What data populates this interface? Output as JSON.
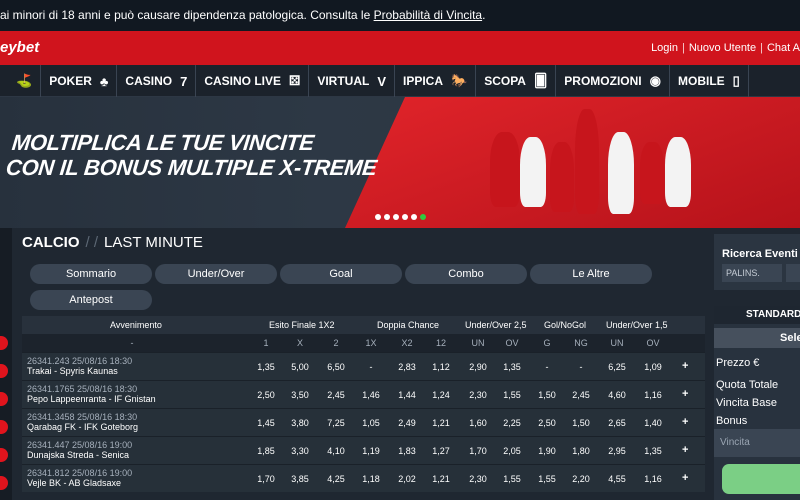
{
  "notice": {
    "text": "ai minori di 18 anni e può causare dipendenza patologica. Consulta le ",
    "link": "Probabilità di Vincita",
    "end": "."
  },
  "header": {
    "brand": "eybet",
    "links": [
      "Login",
      "Nuovo Utente",
      "Chat A"
    ]
  },
  "nav": [
    {
      "label": "",
      "icon": "golf-icon",
      "glyph": "⛳"
    },
    {
      "label": "POKER",
      "icon": "card-suits-icon",
      "glyph": "♣"
    },
    {
      "label": "CASINO",
      "icon": "seven-icon",
      "glyph": "7"
    },
    {
      "label": "CASINO LIVE",
      "icon": "dice-icon",
      "glyph": "⚄"
    },
    {
      "label": "VIRTUAL",
      "icon": "virtual-icon",
      "glyph": "V"
    },
    {
      "label": "IPPICA",
      "icon": "horse-icon",
      "glyph": "🐎"
    },
    {
      "label": "SCOPA",
      "icon": "cards-icon",
      "glyph": "🂠"
    },
    {
      "label": "PROMOZIONI",
      "icon": "promo-icon",
      "glyph": "◉"
    },
    {
      "label": "MOBILE",
      "icon": "mobile-icon",
      "glyph": "▯"
    }
  ],
  "banner": {
    "line1": "MOLTIPLICA LE TUE VINCITE",
    "line2": "CON IL BONUS MULTIPLE X-TREME",
    "slides": 6,
    "active_slide": 5
  },
  "section": {
    "title": "CALCIO",
    "sep": "/ /",
    "subtitle": "LAST MINUTE"
  },
  "filters": [
    "Sommario",
    "Under/Over",
    "Goal",
    "Combo",
    "Le Altre",
    "Antepost"
  ],
  "table": {
    "headers": [
      "Avvenimento",
      "Esito Finale 1X2",
      "Doppia Chance",
      "Under/Over 2,5",
      "Gol/NoGol",
      "Under/Over 1,5"
    ],
    "sub": [
      "-",
      "1",
      "X",
      "2",
      "1X",
      "X2",
      "12",
      "UN",
      "OV",
      "G",
      "NG",
      "UN",
      "OV"
    ],
    "rows": [
      {
        "code": "26341.243 25/08/16 18:30",
        "match": "Trakai - Spyris Kaunas",
        "odds": [
          "1,35",
          "5,00",
          "6,50",
          "-",
          "2,83",
          "1,12",
          "2,90",
          "1,35",
          "-",
          "-",
          "6,25",
          "1,09"
        ]
      },
      {
        "code": "26341.1765 25/08/16 18:30",
        "match": "Pepo Lappeenranta - IF Gnistan",
        "odds": [
          "2,50",
          "3,50",
          "2,45",
          "1,46",
          "1,44",
          "1,24",
          "2,30",
          "1,55",
          "1,50",
          "2,45",
          "4,60",
          "1,16"
        ]
      },
      {
        "code": "26341.3458 25/08/16 18:30",
        "match": "Qarabag FK - IFK Goteborg",
        "odds": [
          "1,45",
          "3,80",
          "7,25",
          "1,05",
          "2,49",
          "1,21",
          "1,60",
          "2,25",
          "2,50",
          "1,50",
          "2,65",
          "1,40"
        ]
      },
      {
        "code": "26341.447 25/08/16 19:00",
        "match": "Dunajska Streda - Senica",
        "odds": [
          "1,85",
          "3,30",
          "4,10",
          "1,19",
          "1,83",
          "1,27",
          "1,70",
          "2,05",
          "1,90",
          "1,80",
          "2,95",
          "1,35"
        ]
      },
      {
        "code": "26341.812 25/08/16 19:00",
        "match": "Vejle BK - AB Gladsaxe",
        "odds": [
          "1,70",
          "3,85",
          "4,25",
          "1,18",
          "2,02",
          "1,21",
          "2,30",
          "1,55",
          "1,55",
          "2,20",
          "4,55",
          "1,16"
        ]
      }
    ],
    "add_label": "+"
  },
  "right": {
    "search_title": "Ricerca Eventi",
    "palins_placeholder": "PALINS.",
    "tab": "STANDARD",
    "select_btn": "Sele",
    "prezzo": "Prezzo €",
    "quota": "Quota Totale",
    "vincita_base": "Vincita Base",
    "bonus": "Bonus",
    "vincita": "Vincita"
  }
}
